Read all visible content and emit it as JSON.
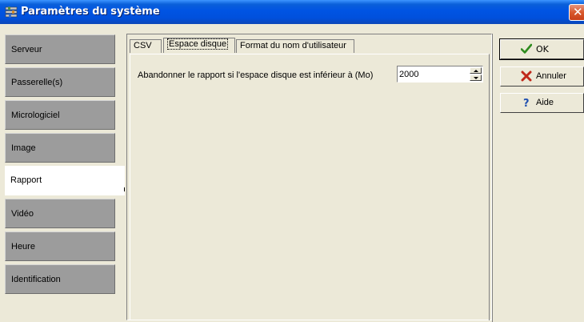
{
  "window": {
    "title": "Paramètres du système",
    "close_icon": "close-icon",
    "app_icon": "settings-icon"
  },
  "nav": {
    "items": [
      {
        "label": "Serveur",
        "active": false
      },
      {
        "label": "Passerelle(s)",
        "active": false
      },
      {
        "label": "Micrologiciel",
        "active": false
      },
      {
        "label": "Image",
        "active": false
      },
      {
        "label": "Rapport",
        "active": true
      },
      {
        "label": "Vidéo",
        "active": false
      },
      {
        "label": "Heure",
        "active": false
      },
      {
        "label": "Identification",
        "active": false
      }
    ]
  },
  "tabs": {
    "items": [
      {
        "label": "CSV",
        "active": false
      },
      {
        "label": "Espace disque",
        "active": true
      },
      {
        "label": "Format du nom d'utilisateur",
        "active": false
      }
    ]
  },
  "disk_space": {
    "label": "Abandonner le rapport si l'espace disque est inférieur à (Mo)",
    "value": "2000"
  },
  "buttons": {
    "ok": {
      "label": "OK",
      "icon": "checkmark-icon"
    },
    "cancel": {
      "label": "Annuler",
      "icon": "x-icon"
    },
    "help": {
      "label": "Aide",
      "icon": "question-icon"
    }
  },
  "colors": {
    "titlebar": "#0054e3",
    "nav_inactive": "#9c9c9c",
    "nav_active": "#ffffff",
    "window_bg": "#ece9d8"
  }
}
